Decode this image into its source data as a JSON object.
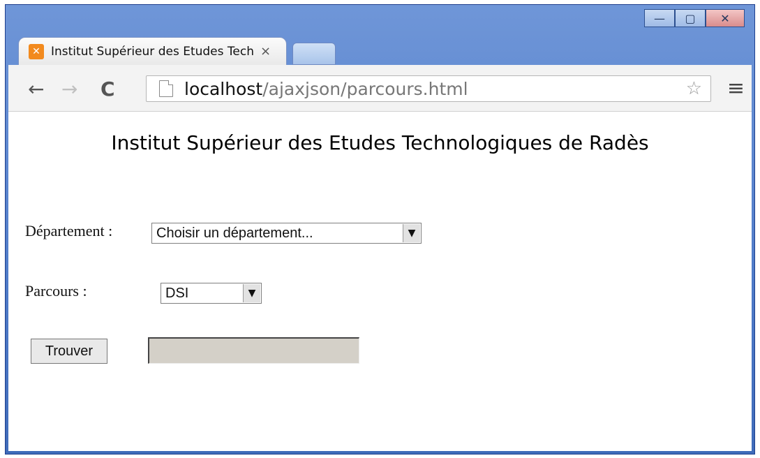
{
  "browser": {
    "tab_title": "Institut Supérieur des Etudes Technologiques de Radès",
    "tab_close": "×",
    "url_host": "localhost",
    "url_path": "/ajaxjson/parcours.html",
    "icons": {
      "favicon": "xampp-icon",
      "back": "arrow-left-icon",
      "forward": "arrow-right-icon",
      "reload": "reload-icon",
      "page": "page-icon",
      "star": "star-icon",
      "menu": "hamburger-menu-icon"
    }
  },
  "page": {
    "heading": "Institut Supérieur des Etudes Technologiques de Radès",
    "departement_label": "Département :",
    "departement_select_value": "Choisir un département...",
    "parcours_label": "Parcours :",
    "parcours_select_value": "DSI",
    "find_button": "Trouver",
    "result_value": ""
  },
  "colors": {
    "window_blue": "#4f7bc8",
    "favicon_orange": "#f28a1e",
    "result_box": "#d4d0c8"
  }
}
